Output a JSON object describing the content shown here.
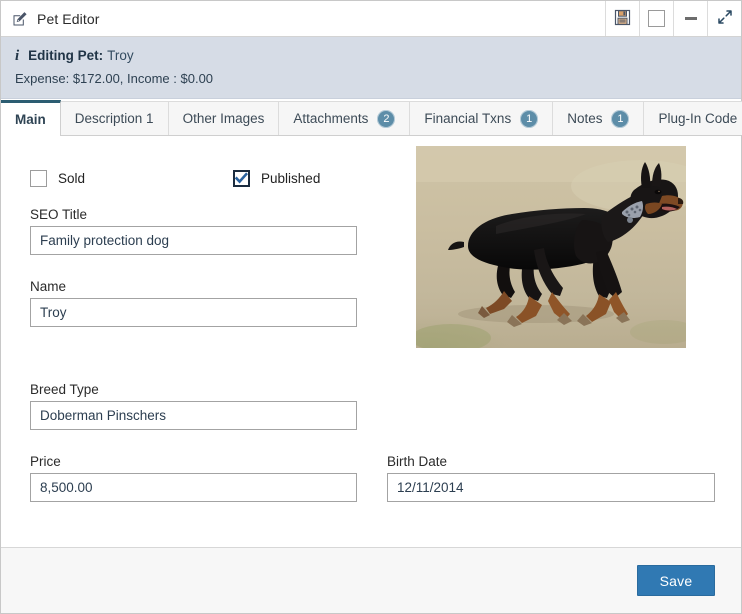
{
  "window": {
    "title": "Pet Editor",
    "title_icon": "edit-pencil-icon",
    "buttons": [
      {
        "name": "save-icon-button",
        "icon": "floppy-disk-icon",
        "label": ""
      },
      {
        "name": "restore-button",
        "icon": "square-icon",
        "label": ""
      },
      {
        "name": "minimize-button",
        "icon": "minimize-dash-icon",
        "label": ""
      },
      {
        "name": "expand-button",
        "icon": "diagonal-arrows-icon",
        "label": ""
      }
    ]
  },
  "infobar": {
    "icon": "info-icon",
    "icon_glyph": "i",
    "heading_label": "Editing Pet:",
    "heading_value": "Troy",
    "summary": "Expense: $172.00, Income : $0.00"
  },
  "tabs": [
    {
      "label": "Main",
      "badge": "",
      "active": true
    },
    {
      "label": "Description 1",
      "badge": "",
      "active": false
    },
    {
      "label": "Other Images",
      "badge": "",
      "active": false
    },
    {
      "label": "Attachments",
      "badge": "2",
      "active": false
    },
    {
      "label": "Financial Txns",
      "badge": "1",
      "active": false
    },
    {
      "label": "Notes",
      "badge": "1",
      "active": false
    },
    {
      "label": "Plug-In Code",
      "badge": "",
      "active": false
    }
  ],
  "form": {
    "sold": {
      "label": "Sold",
      "checked": false
    },
    "published": {
      "label": "Published",
      "checked": true
    },
    "seo_title": {
      "label": "SEO Title",
      "value": "Family protection dog",
      "placeholder": ""
    },
    "name": {
      "label": "Name",
      "value": "Troy",
      "placeholder": ""
    },
    "breed_type": {
      "label": "Breed Type",
      "value": "Doberman Pinschers",
      "placeholder": ""
    },
    "price": {
      "label": "Price",
      "value": "8,500.00",
      "placeholder": ""
    },
    "birth_date": {
      "label": "Birth Date",
      "value": "12/11/2014",
      "placeholder": ""
    }
  },
  "pet_image": {
    "name": "pet-photo",
    "alt": "Running Doberman Pinscher dog on sandy ground"
  },
  "footer": {
    "save_label": "Save"
  },
  "colors": {
    "infobar_bg": "#d6dce6",
    "active_tab_accent": "#2c5d72",
    "badge_bg": "#5d8da8",
    "save_button": "#3079b3",
    "checkbox_checked_border": "#1b2c3f",
    "checkmark": "#2a63a0"
  }
}
